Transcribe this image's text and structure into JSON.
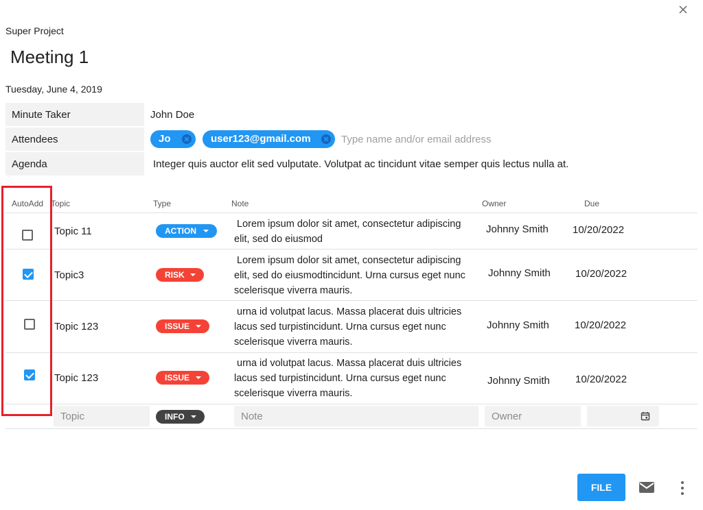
{
  "dialog": {
    "project": "Super Project",
    "title": "Meeting 1",
    "date": "Tuesday, June 4, 2019"
  },
  "details": {
    "minute_taker": {
      "label": "Minute Taker",
      "value": "John Doe"
    },
    "attendees": {
      "label": "Attendees",
      "chips": [
        "Jo",
        "user123@gmail.com"
      ],
      "placeholder": "Type name and/or email address"
    },
    "agenda": {
      "label": "Agenda",
      "value": "Integer quis auctor elit sed vulputate. Volutpat ac tincidunt vitae semper quis lectus nulla at."
    }
  },
  "table": {
    "headers": {
      "autoadd": "AutoAdd",
      "topic": "Topic",
      "type": "Type",
      "note": "Note",
      "owner": "Owner",
      "due": "Due"
    },
    "rows": [
      {
        "autoadd": false,
        "topic": "Topic 11",
        "type": "ACTION",
        "type_color": "#2196f3",
        "note_lines": [
          "Lorem ipsum dolor sit amet, consectetur adipiscing",
          "elit, sed do eiusmod"
        ],
        "owner": "Johnny Smith",
        "due": "10/20/2022"
      },
      {
        "autoadd": true,
        "topic": "Topic3",
        "type": "RISK",
        "type_color": "#f44336",
        "note_lines": [
          "Lorem ipsum dolor sit amet, consectetur adipiscing",
          "elit, sed do eiusmodtincidunt. Urna cursus eget nunc",
          "scelerisque viverra mauris."
        ],
        "owner": "Johnny Smith",
        "due": "10/20/2022"
      },
      {
        "autoadd": false,
        "topic": "Topic 123",
        "type": "ISSUE",
        "type_color": "#f44336",
        "note_lines": [
          "urna id volutpat lacus. Massa placerat duis ultricies",
          "lacus sed turpistincidunt. Urna cursus eget nunc",
          "scelerisque viverra mauris."
        ],
        "owner": "Johnny Smith",
        "due": "10/20/2022"
      },
      {
        "autoadd": true,
        "topic": "Topic 123",
        "type": "ISSUE",
        "type_color": "#f44336",
        "note_lines": [
          "urna id volutpat lacus. Massa placerat duis ultricies",
          "lacus sed turpistincidunt. Urna cursus eget nunc",
          "scelerisque viverra mauris."
        ],
        "owner": "Johnny Smith",
        "due": "10/20/2022"
      }
    ],
    "new_row": {
      "topic_placeholder": "Topic",
      "type": "INFO",
      "type_color": "#424242",
      "note_placeholder": "Note",
      "owner_placeholder": "Owner",
      "due_icon": "calendar-icon"
    }
  },
  "footer": {
    "file_label": "FILE",
    "mail_icon": "mail-icon",
    "more_icon": "more-vertical-icon"
  },
  "colors": {
    "accent": "#2196f3",
    "risk": "#f44336",
    "info": "#424242",
    "highlight": "#e5202a"
  },
  "icons": {
    "close": "close-icon"
  }
}
